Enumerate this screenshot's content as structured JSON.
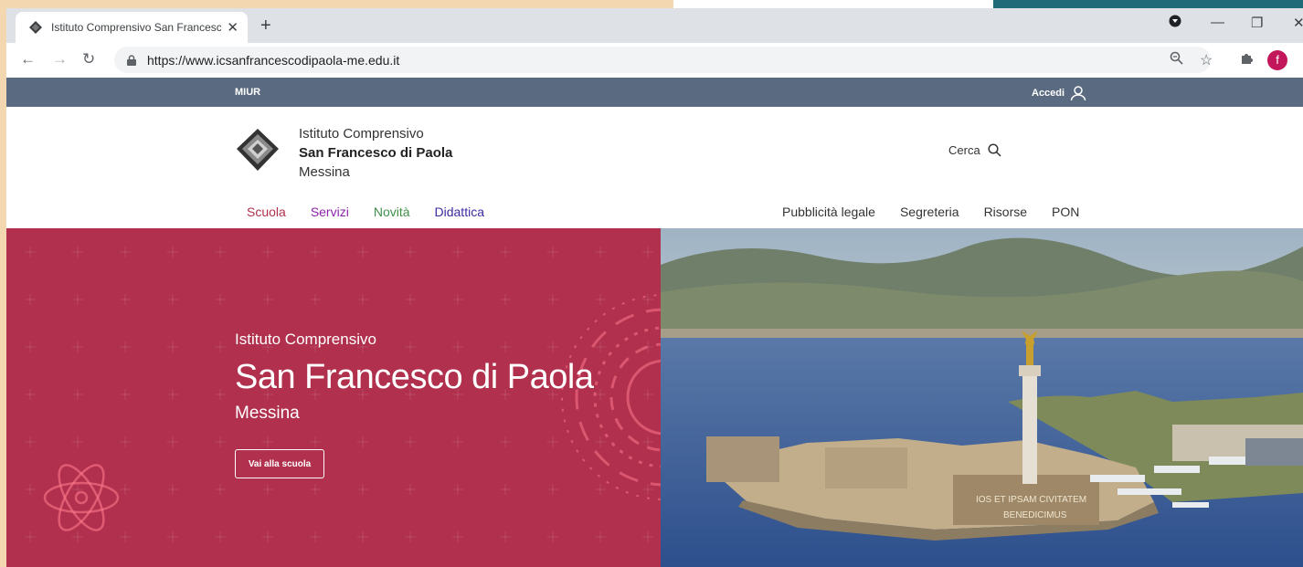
{
  "browser": {
    "tab_title": "Istituto Comprensivo San Francesco di Paola",
    "url": "https://www.icsanfrancescodipaola-me.edu.it"
  },
  "site": {
    "topbar": {
      "left_label": "MIUR",
      "login_label": "Accedi"
    },
    "brand": {
      "line1": "Istituto Comprensivo",
      "line2": "San Francesco di Paola",
      "line3": "Messina"
    },
    "search_label": "Cerca",
    "main_nav": [
      {
        "label": "Scuola",
        "color": "#b0304d"
      },
      {
        "label": "Servizi",
        "color": "#8e24aa"
      },
      {
        "label": "Novità",
        "color": "#3f8f4a"
      },
      {
        "label": "Didattica",
        "color": "#3b2ba0"
      }
    ],
    "secondary_nav": [
      "Pubblicità legale",
      "Segreteria",
      "Risorse",
      "PON"
    ],
    "hero": {
      "kicker": "Istituto Comprensivo",
      "title": "San Francesco di Paola",
      "city": "Messina",
      "button_label": "Vai alla scuola",
      "accent_color": "#b0304d",
      "monument_inscription_1": "IOS ET IPSAM CIVITATEM",
      "monument_inscription_2": "BENEDICIMUS"
    }
  }
}
